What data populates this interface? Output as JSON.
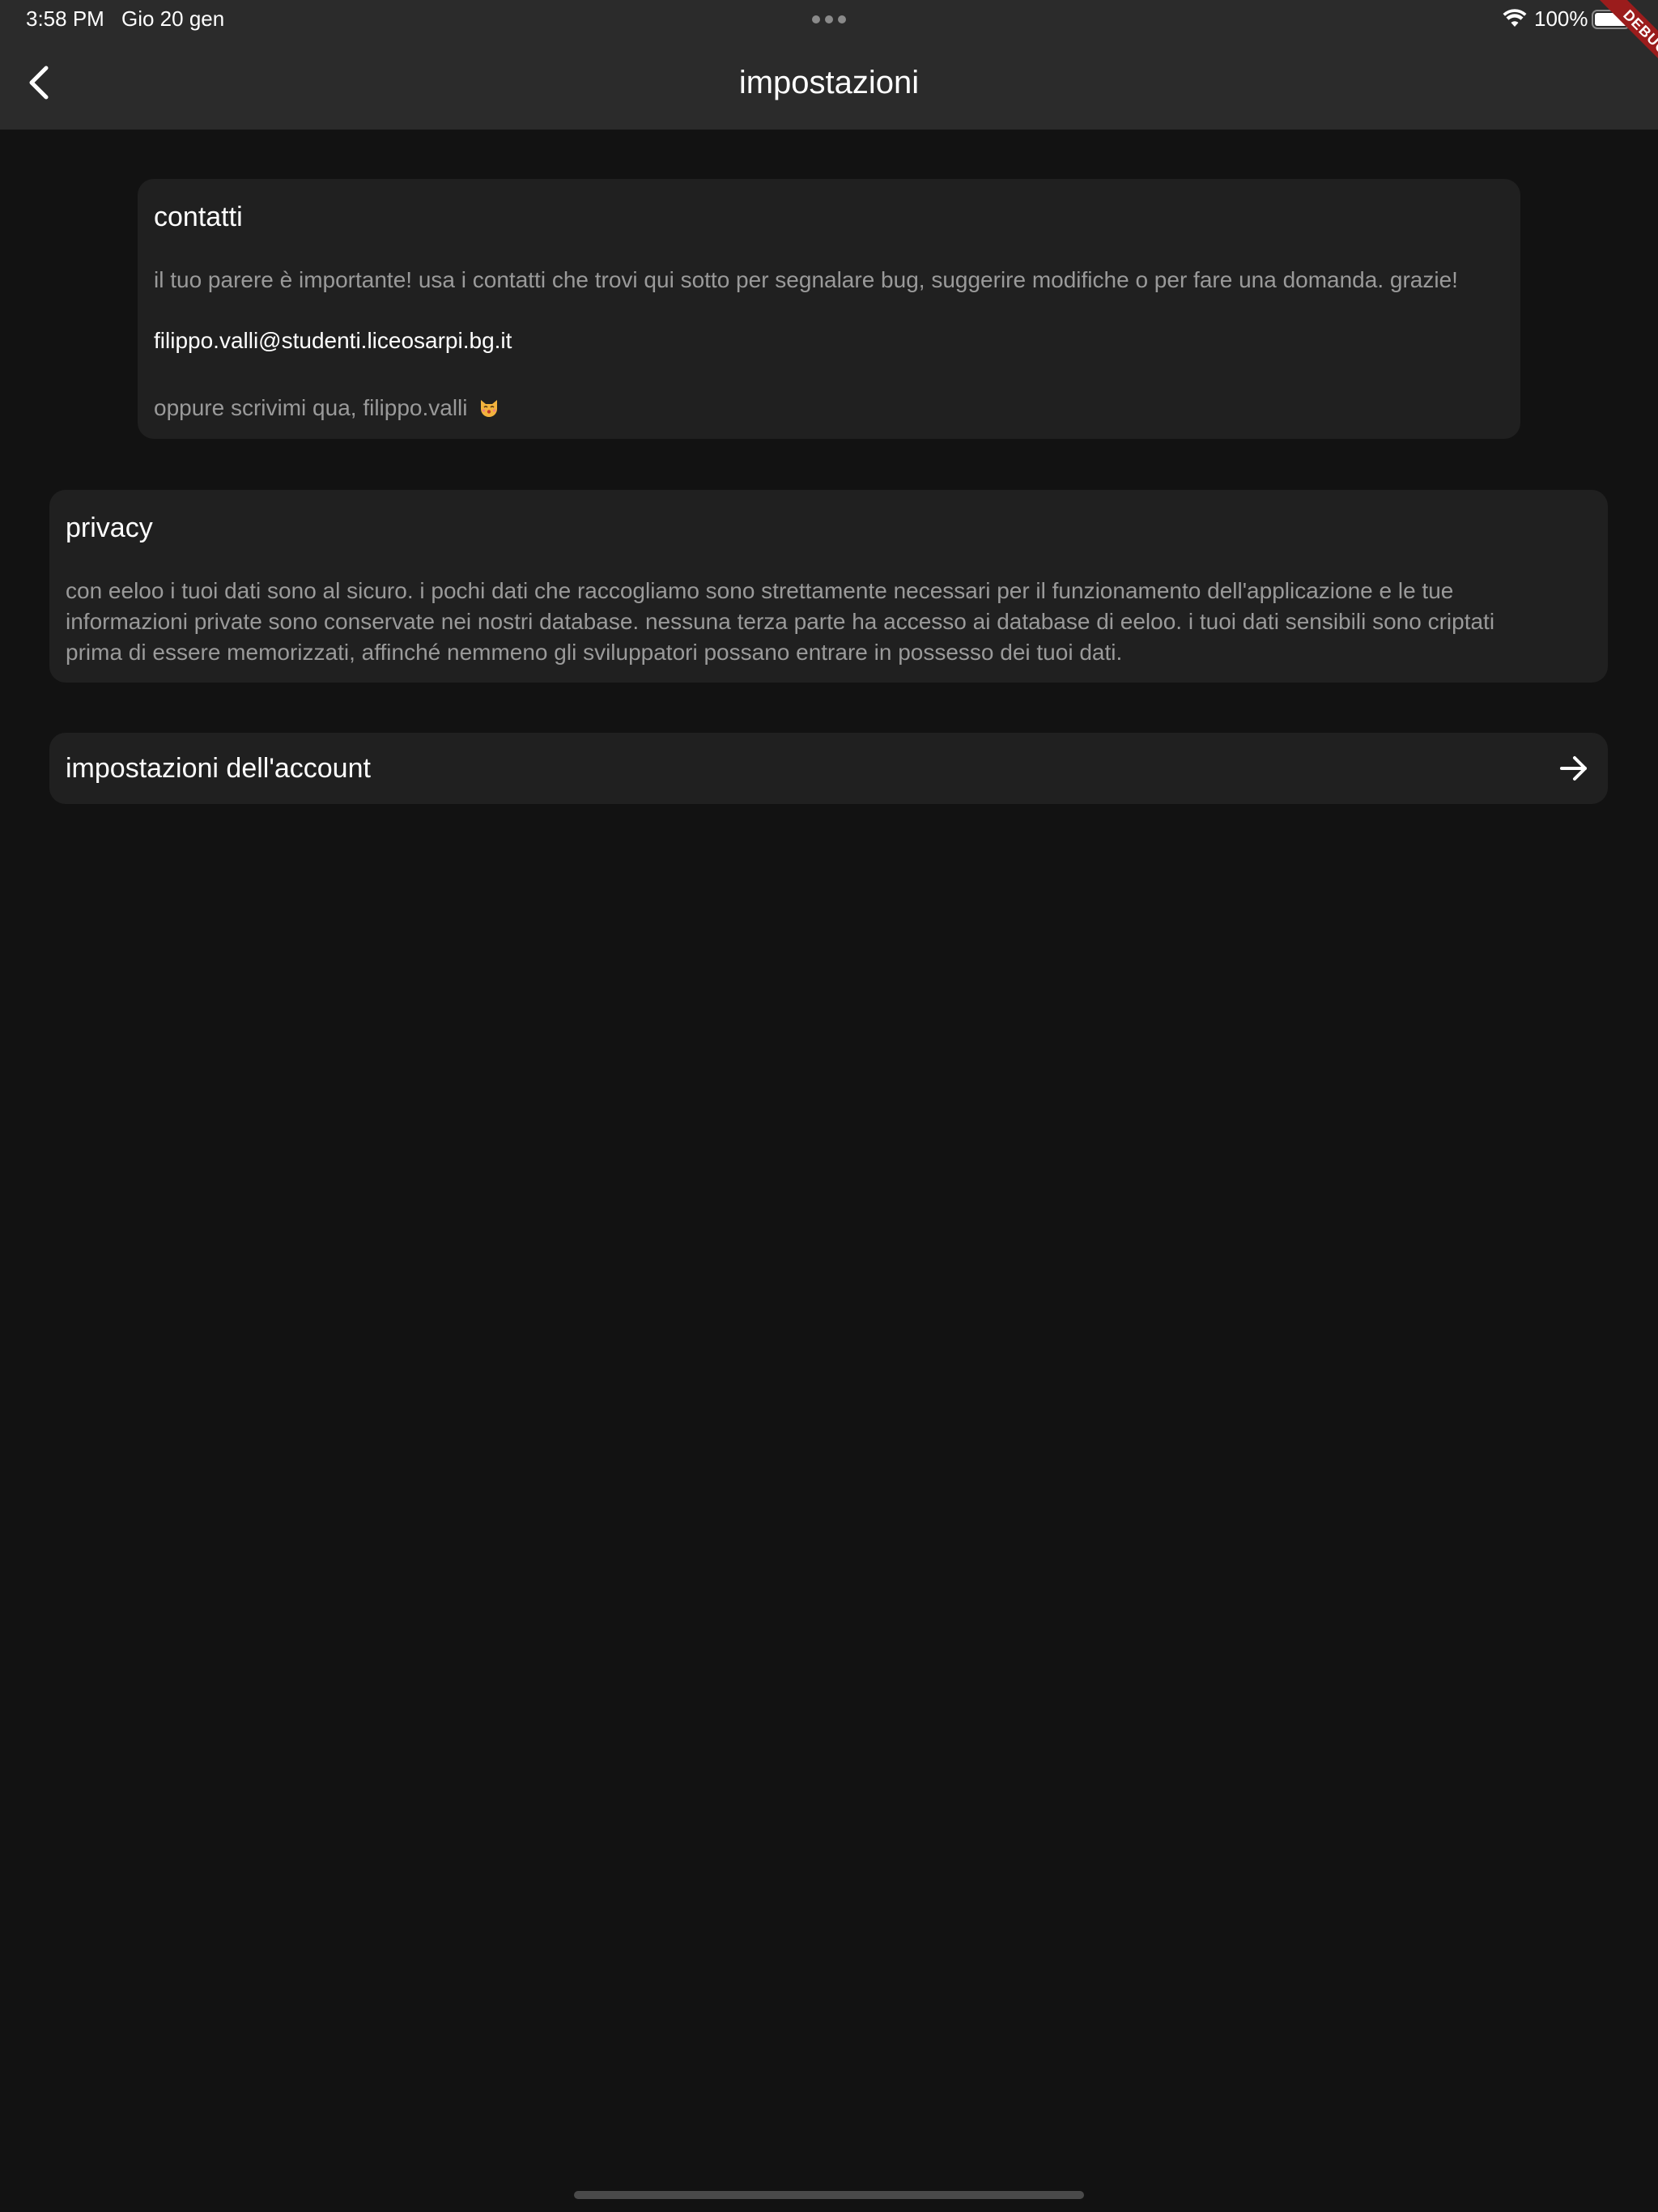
{
  "status_bar": {
    "time": "3:58 PM",
    "date": "Gio 20 gen",
    "battery_percent": "100%",
    "battery_level": 1.0
  },
  "app_bar": {
    "title": "impostazioni",
    "back_icon": "chevron-left-icon"
  },
  "debug_banner": {
    "label": "DEBUG",
    "color": "#9b1c1c"
  },
  "contatti": {
    "title": "contatti",
    "description": "il tuo parere è importante! usa i contatti che trovi qui sotto per segnalare bug, suggerire modifiche o per fare una domanda. grazie!",
    "email": "filippo.valli@studenti.liceosarpi.bg.it",
    "alt_contact": "oppure scrivimi qua, filippo.valli",
    "alt_contact_icon": "cat-face-emoji-icon"
  },
  "privacy": {
    "title": "privacy",
    "lines": [
      "con eeloo i tuoi dati sono al sicuro. i pochi dati che raccogliamo sono strettamente necessari per il funzionamento dell'applicazione e le tue",
      "informazioni private sono conservate nei nostri database. nessuna terza parte ha accesso ai database di eeloo. i tuoi dati sensibili sono criptati",
      "prima di essere memorizzati, affinché nemmeno gli sviluppatori possano entrare in possesso dei tuoi dati."
    ]
  },
  "account": {
    "label": "impostazioni dell'account",
    "icon": "arrow-right-icon"
  },
  "colors": {
    "background": "#121212",
    "bar": "#2b2b2b",
    "card": "#202020",
    "text_primary": "#ffffff",
    "text_secondary": "#9a9a9a"
  }
}
